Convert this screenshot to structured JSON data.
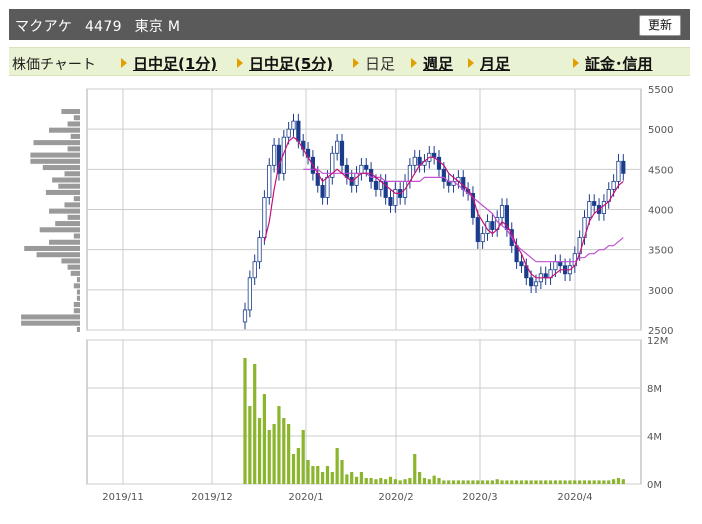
{
  "header": {
    "name": "マクアケ",
    "code": "4479",
    "market": "東京 M",
    "refresh_label": "更新"
  },
  "nav": {
    "chart_label": "株価チャート",
    "items": [
      {
        "label": "日中足(1分)",
        "link": true
      },
      {
        "label": "日中足(5分)",
        "link": true
      },
      {
        "label": "日足",
        "link": false
      },
      {
        "label": "週足",
        "link": true
      },
      {
        "label": "月足",
        "link": true
      }
    ],
    "extra": "証金･信用"
  },
  "colors": {
    "candle": "#1b3c8c",
    "ma_short": "#c8107a",
    "ma_long": "#c24fd4",
    "volume": "#8ab52c",
    "grid": "#cccccc"
  },
  "chart_data": [
    {
      "type": "candlestick",
      "y_ticks": [
        "5500",
        "5000",
        "4500",
        "4000",
        "3500",
        "3000",
        "2500"
      ],
      "ylim": [
        2500,
        5500
      ],
      "x_ticks": [
        "2019/11",
        "2019/12",
        "2020/1",
        "2020/2",
        "2020/3",
        "2020/4"
      ],
      "close": [
        2750,
        3150,
        3350,
        3650,
        4150,
        4550,
        4800,
        4450,
        4900,
        5000,
        5100,
        4850,
        4750,
        4650,
        4450,
        4300,
        4150,
        4400,
        4700,
        4850,
        4550,
        4400,
        4300,
        4450,
        4550,
        4500,
        4350,
        4250,
        4350,
        4150,
        4050,
        4250,
        4150,
        4350,
        4550,
        4650,
        4550,
        4600,
        4700,
        4650,
        4500,
        4350,
        4300,
        4350,
        4400,
        4250,
        4200,
        3900,
        3600,
        3700,
        3850,
        3750,
        3900,
        4050,
        3750,
        3550,
        3350,
        3300,
        3150,
        3050,
        3100,
        3200,
        3150,
        3250,
        3350,
        3300,
        3200,
        3300,
        3450,
        3650,
        3900,
        4100,
        4050,
        3950,
        4100,
        4250,
        4350,
        4600,
        4450
      ],
      "ma_short": [
        null,
        null,
        null,
        null,
        3600,
        3850,
        4250,
        4550,
        4700,
        4850,
        4900,
        4850,
        4750,
        4650,
        4550,
        4450,
        4350,
        4400,
        4450,
        4500,
        4450,
        4400,
        4350,
        4400,
        4450,
        4450,
        4450,
        4400,
        4350,
        4300,
        4250,
        4200,
        4200,
        4250,
        4350,
        4450,
        4550,
        4600,
        4650,
        4650,
        4600,
        4550,
        4450,
        4400,
        4350,
        4300,
        4250,
        4150,
        3950,
        3850,
        3750,
        3700,
        3750,
        3850,
        3800,
        3700,
        3550,
        3450,
        3300,
        3200,
        3150,
        3150,
        3150,
        3150,
        3200,
        3250,
        3250,
        3250,
        3300,
        3450,
        3650,
        3850,
        3950,
        4000,
        4050,
        4100,
        4200,
        4300,
        4350
      ],
      "ma_long": [
        null,
        null,
        null,
        null,
        null,
        null,
        null,
        null,
        null,
        null,
        null,
        null,
        4500,
        4500,
        4500,
        4500,
        4450,
        4450,
        4450,
        4450,
        4450,
        4450,
        4450,
        4450,
        4450,
        4450,
        4400,
        4400,
        4400,
        4350,
        4350,
        4350,
        4350,
        4350,
        4350,
        4350,
        4350,
        4400,
        4400,
        4400,
        4400,
        4400,
        4350,
        4350,
        4300,
        4250,
        4200,
        4150,
        4100,
        4050,
        4000,
        3950,
        3850,
        3800,
        3750,
        3650,
        3550,
        3500,
        3450,
        3400,
        3350,
        3350,
        3350,
        3350,
        3350,
        3350,
        3350,
        3350,
        3350,
        3400,
        3400,
        3450,
        3450,
        3500,
        3500,
        3550,
        3550,
        3600,
        3650
      ]
    },
    {
      "type": "bar",
      "y_ticks": [
        "12M",
        "8M",
        "4M",
        "0M"
      ],
      "ylim": [
        0,
        12
      ],
      "x_ticks": [
        "2019/11",
        "2019/12",
        "2020/1",
        "2020/2",
        "2020/3",
        "2020/4"
      ],
      "values": [
        10.5,
        6.5,
        10,
        5.5,
        7.5,
        4.5,
        5,
        6.5,
        5.5,
        5,
        2.5,
        3,
        4.5,
        2,
        1.5,
        1.5,
        1,
        1.5,
        1,
        3,
        2,
        0.8,
        1,
        0.6,
        1,
        0.5,
        0.5,
        0.4,
        0.5,
        0.4,
        0.6,
        0.4,
        0.3,
        0.4,
        0.5,
        2.5,
        1,
        0.5,
        0.4,
        0.7,
        0.5,
        0.3,
        0.3,
        0.3,
        0.3,
        0.3,
        0.3,
        0.3,
        0.3,
        0.3,
        0.3,
        0.3,
        0.4,
        0.3,
        0.3,
        0.3,
        0.3,
        0.3,
        0.3,
        0.3,
        0.3,
        0.3,
        0.3,
        0.3,
        0.3,
        0.3,
        0.3,
        0.3,
        0.3,
        0.3,
        0.3,
        0.3,
        0.3,
        0.3,
        0.3,
        0.3,
        0.4,
        0.5,
        0.4
      ]
    }
  ],
  "volume_profile": [
    0.3,
    0.1,
    0.2,
    0.5,
    0.15,
    0.75,
    0.2,
    0.8,
    0.8,
    0.6,
    0.25,
    0.45,
    0.35,
    0.55,
    0.1,
    0.25,
    0.5,
    0.2,
    0.4,
    0.65,
    0.1,
    0.5,
    0.9,
    0.7,
    0.3,
    0.2,
    0.15,
    0.05,
    0.1,
    0.05,
    0.05,
    0.1,
    0.1,
    0.95,
    0.95,
    0.05
  ]
}
